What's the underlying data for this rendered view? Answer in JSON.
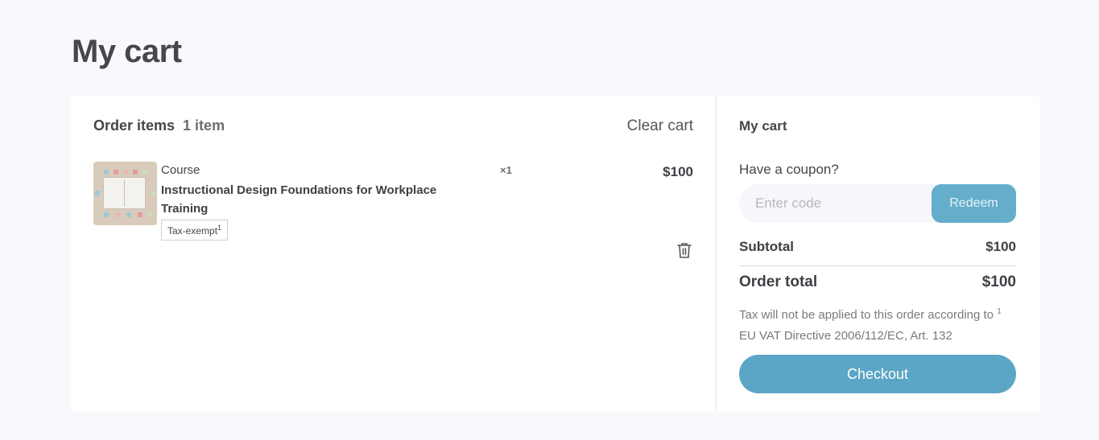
{
  "page": {
    "title": "My cart"
  },
  "items_panel": {
    "header_label": "Order items",
    "item_count": "1 item",
    "clear_cart_label": "Clear cart",
    "items": [
      {
        "kind": "Course",
        "name": "Instructional Design Foundations for Workplace Training",
        "tax_tag": "Tax-exempt",
        "tax_footnote": "1",
        "quantity": "×1",
        "price": "$100",
        "delete_icon": "trash-icon"
      }
    ]
  },
  "summary": {
    "title": "My cart",
    "coupon_label": "Have a coupon?",
    "coupon_placeholder": "Enter code",
    "redeem_label": "Redeem",
    "subtotal_label": "Subtotal",
    "subtotal_value": "$100",
    "total_label": "Order total",
    "total_value": "$100",
    "tax_note_prefix": "Tax will not be applied to this order according to",
    "tax_note_footnote": "1",
    "tax_note_suffix": "EU VAT Directive 2006/112/EC, Art. 132",
    "checkout_label": "Checkout"
  },
  "colors": {
    "background": "#f9f9fd",
    "accent": "#5ba6c6",
    "redeem": "#64aecb"
  }
}
